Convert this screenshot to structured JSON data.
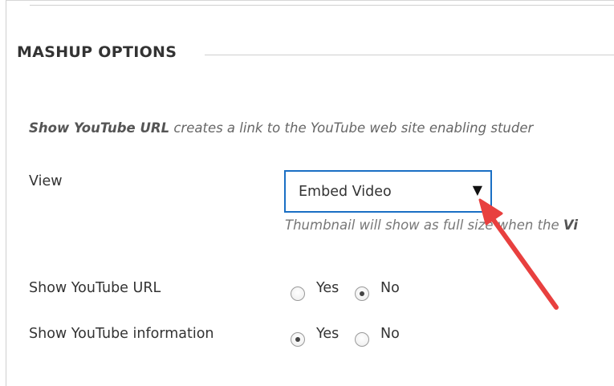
{
  "section": {
    "heading": "MASHUP OPTIONS"
  },
  "intro": {
    "bold_text": "Show YouTube URL",
    "rest_text": " creates a link to the YouTube web site enabling studer"
  },
  "view": {
    "label": "View",
    "selected": "Embed Video",
    "help_prefix": "Thumbnail will show as full size when the ",
    "help_bold": "Vi"
  },
  "show_url": {
    "label": "Show YouTube URL",
    "options": [
      {
        "label": "Yes",
        "checked": false
      },
      {
        "label": "No",
        "checked": true
      }
    ]
  },
  "show_info": {
    "label": "Show YouTube information",
    "options": [
      {
        "label": "Yes",
        "checked": true
      },
      {
        "label": "No",
        "checked": false
      }
    ]
  },
  "colors": {
    "focus_border": "#1a6fc4",
    "annotation_arrow": "#e8403f"
  },
  "icons": {
    "dropdown": "caret-down-icon",
    "annotation": "annotation-arrow-icon"
  }
}
